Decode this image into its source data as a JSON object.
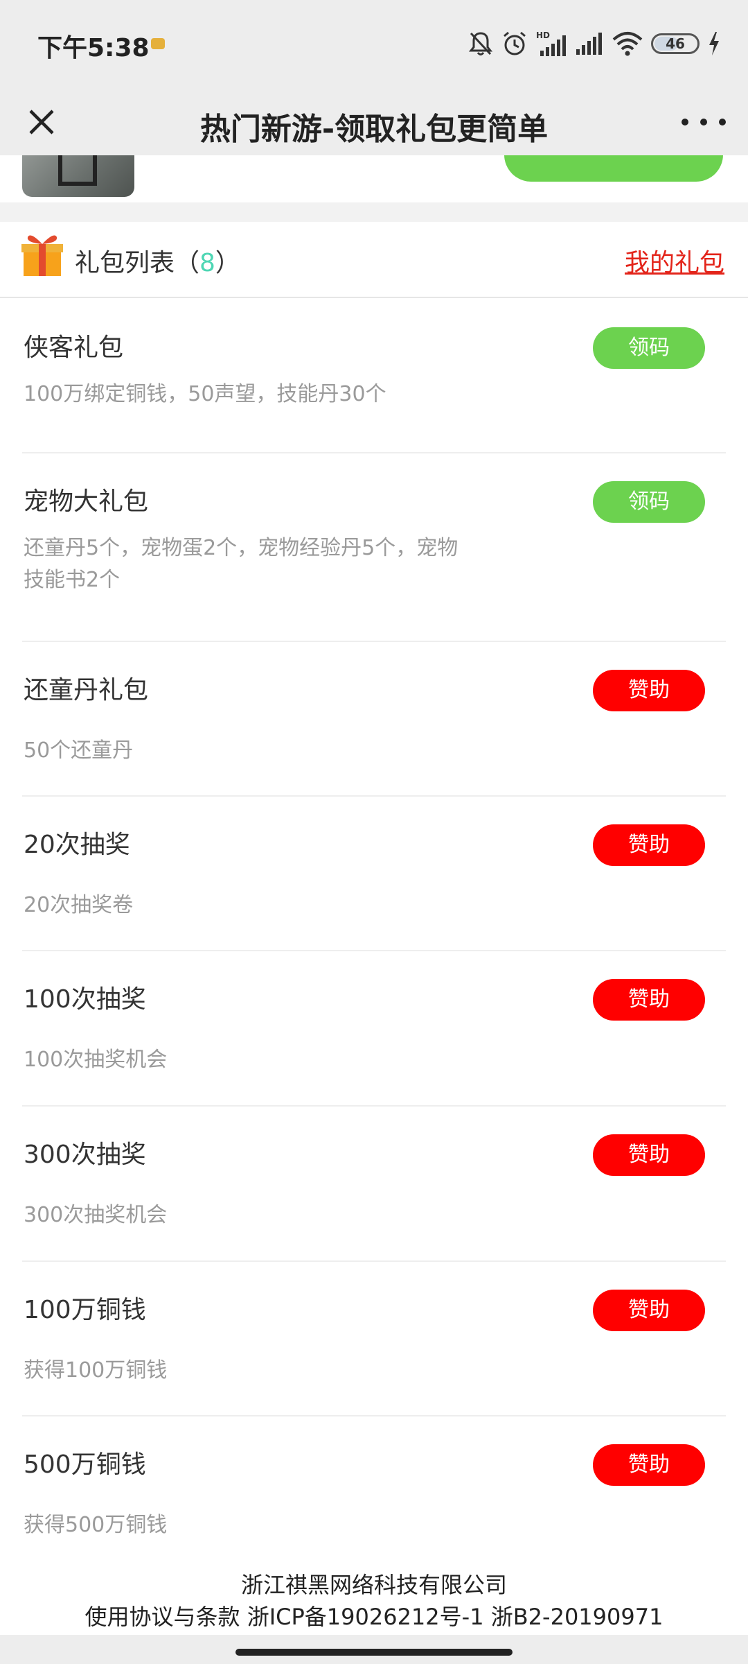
{
  "status_bar": {
    "time": "下午5:38",
    "battery": "46",
    "icons": [
      "bell-off-icon",
      "alarm-icon",
      "hd-signal-icon",
      "signal-icon",
      "wifi-icon",
      "battery-icon",
      "charging-icon"
    ]
  },
  "nav": {
    "title": "热门新游-领取礼包更简单",
    "close_icon": "close-icon",
    "more_icon": "more-icon"
  },
  "gift_list": {
    "title_prefix": "礼包列表（",
    "count": "8",
    "title_suffix": "）",
    "my_gifts": "我的礼包",
    "items": [
      {
        "name": "侠客礼包",
        "desc": "100万绑定铜钱，50声望，技能丹30个",
        "button": "领码",
        "button_color": "#6cd24f"
      },
      {
        "name": "宠物大礼包",
        "desc_line1": "还童丹5个，宠物蛋2个，宠物经验丹5个，宠物",
        "desc_line2": "技能书2个",
        "button": "领码",
        "button_color": "#6cd24f"
      },
      {
        "name": "还童丹礼包",
        "desc": "50个还童丹",
        "button": "赞助",
        "button_color": "#ff0000"
      },
      {
        "name": "20次抽奖",
        "desc": "20次抽奖卷",
        "button": "赞助",
        "button_color": "#ff0000"
      },
      {
        "name": "100次抽奖",
        "desc": "100次抽奖机会",
        "button": "赞助",
        "button_color": "#ff0000"
      },
      {
        "name": "300次抽奖",
        "desc": "300次抽奖机会",
        "button": "赞助",
        "button_color": "#ff0000"
      },
      {
        "name": "100万铜钱",
        "desc": "获得100万铜钱",
        "button": "赞助",
        "button_color": "#ff0000"
      },
      {
        "name": "500万铜钱",
        "desc": "获得500万铜钱",
        "button": "赞助",
        "button_color": "#ff0000"
      }
    ]
  },
  "footer": {
    "company": "浙江祺黑网络科技有限公司",
    "legal": "使用协议与条款 浙ICP备19026212号-1 浙B2-20190971"
  }
}
